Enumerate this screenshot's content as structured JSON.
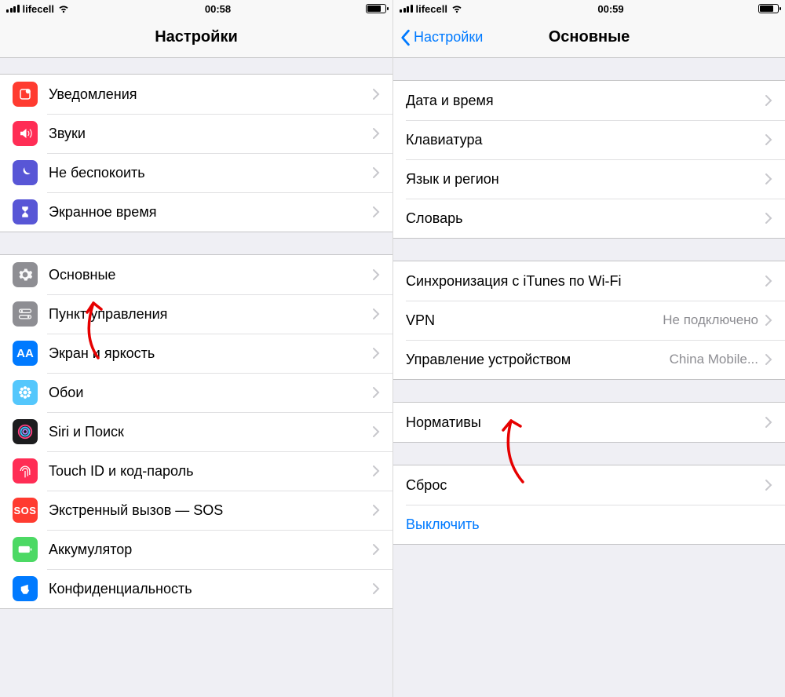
{
  "left": {
    "status": {
      "carrier": "lifecell",
      "time": "00:58"
    },
    "title": "Настройки",
    "group1": [
      {
        "label": "Уведомления"
      },
      {
        "label": "Звуки"
      },
      {
        "label": "Не беспокоить"
      },
      {
        "label": "Экранное время"
      }
    ],
    "group2": [
      {
        "label": "Основные"
      },
      {
        "label": "Пункт управления"
      },
      {
        "label": "Экран и яркость"
      },
      {
        "label": "Обои"
      },
      {
        "label": "Siri и Поиск"
      },
      {
        "label": "Touch ID и код-пароль"
      },
      {
        "label": "Экстренный вызов — SOS"
      },
      {
        "label": "Аккумулятор"
      },
      {
        "label": "Конфиденциальность"
      }
    ]
  },
  "right": {
    "status": {
      "carrier": "lifecell",
      "time": "00:59"
    },
    "back": "Настройки",
    "title": "Основные",
    "group1": [
      {
        "label": "Дата и время"
      },
      {
        "label": "Клавиатура"
      },
      {
        "label": "Язык и регион"
      },
      {
        "label": "Словарь"
      }
    ],
    "group2": [
      {
        "label": "Синхронизация с iTunes по Wi-Fi"
      },
      {
        "label": "VPN",
        "detail": "Не подключено"
      },
      {
        "label": "Управление устройством",
        "detail": "China Mobile..."
      }
    ],
    "group3": [
      {
        "label": "Нормативы"
      }
    ],
    "group4": [
      {
        "label": "Сброс"
      },
      {
        "label": "Выключить",
        "link": true,
        "no_chevron": true
      }
    ]
  }
}
